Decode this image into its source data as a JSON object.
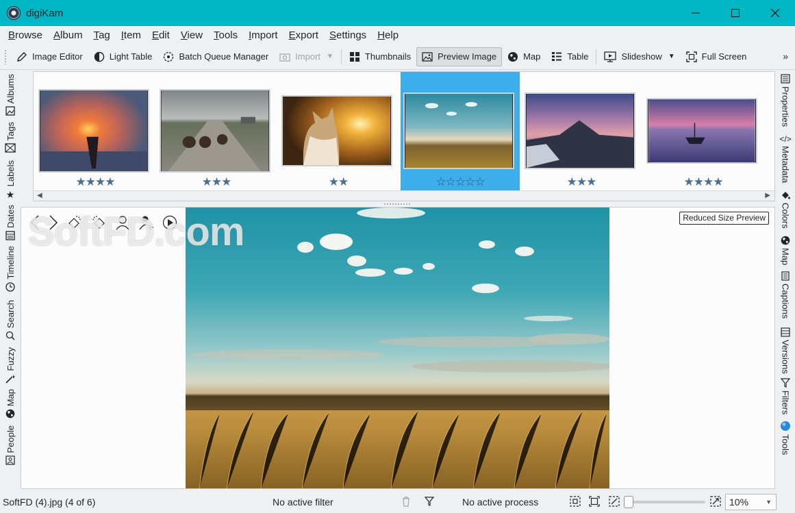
{
  "window": {
    "title": "digiKam",
    "controls": {
      "minimize": "—",
      "maximize": "☐",
      "close": "✕"
    }
  },
  "menu": [
    {
      "label": "Browse",
      "u": "B",
      "rest": "rowse"
    },
    {
      "label": "Album",
      "u": "A",
      "rest": "lbum"
    },
    {
      "label": "Tag",
      "u": "T",
      "rest": "ag"
    },
    {
      "label": "Item",
      "u": "I",
      "rest": "tem"
    },
    {
      "label": "Edit",
      "u": "E",
      "rest": "dit"
    },
    {
      "label": "View",
      "u": "V",
      "rest": "iew"
    },
    {
      "label": "Tools",
      "u": "T",
      "rest": "ools"
    },
    {
      "label": "Import",
      "u": "I",
      "rest": "mport"
    },
    {
      "label": "Export",
      "u": "E",
      "rest": "xport"
    },
    {
      "label": "Settings",
      "u": "S",
      "rest": "ettings"
    },
    {
      "label": "Help",
      "u": "H",
      "rest": "elp"
    }
  ],
  "toolbar": {
    "image_editor": "Image Editor",
    "light_table": "Light Table",
    "batch_queue": "Batch Queue Manager",
    "import": "Import",
    "thumbnails": "Thumbnails",
    "preview_image": "Preview Image",
    "map": "Map",
    "table": "Table",
    "slideshow": "Slideshow",
    "full_screen": "Full Screen",
    "more": "»"
  },
  "left_tabs": [
    "Albums",
    "Tags",
    "Labels",
    "Dates",
    "Timeline",
    "Search",
    "Fuzzy",
    "Map",
    "People"
  ],
  "right_tabs": [
    "Properties",
    "Metadata",
    "Colors",
    "Map",
    "Captions",
    "Versions",
    "Filters",
    "Tools"
  ],
  "thumbnails": [
    {
      "name": "thumb-fire-snow",
      "rating": 4,
      "stars": "★★★★"
    },
    {
      "name": "thumb-bears-road",
      "rating": 3,
      "stars": "★★★"
    },
    {
      "name": "thumb-cat-sunset",
      "rating": 2,
      "stars": "★★"
    },
    {
      "name": "thumb-field-sky",
      "rating": 0,
      "stars": "☆☆☆☆☆",
      "selected": true
    },
    {
      "name": "thumb-mountain-dusk",
      "rating": 3,
      "stars": "★★★"
    },
    {
      "name": "thumb-boat-lake",
      "rating": 4,
      "stars": "★★★★"
    }
  ],
  "preview": {
    "reduced_label": "Reduced Size Preview",
    "watermark": "SoftFD.com"
  },
  "status": {
    "file": "SoftFD (4).jpg (4 of 6)",
    "filter": "No active filter",
    "process": "No active process",
    "zoom": "10%",
    "zoom_level": 0.1
  }
}
